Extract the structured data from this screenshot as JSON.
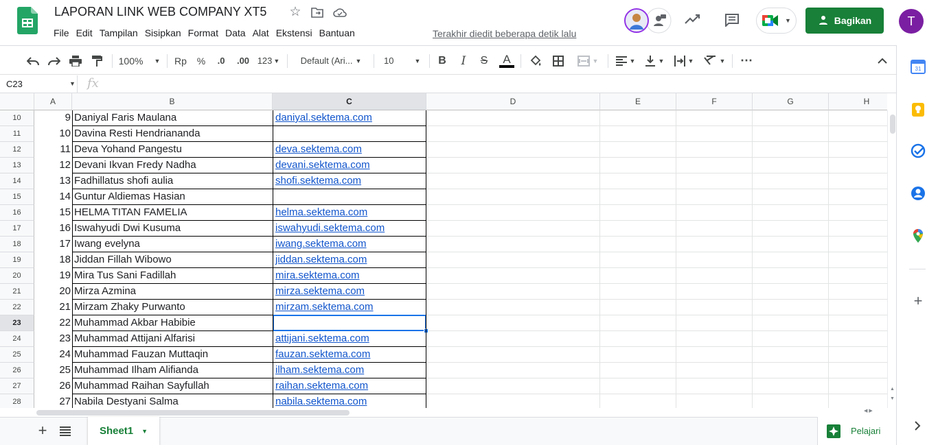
{
  "window": {
    "title": "LAPORAN LINK WEB COMPANY XT5",
    "last_edit": "Terakhir diedit beberapa detik lalu"
  },
  "menu": [
    "File",
    "Edit",
    "Tampilan",
    "Sisipkan",
    "Format",
    "Data",
    "Alat",
    "Ekstensi",
    "Bantuan"
  ],
  "header": {
    "share_label": "Bagikan",
    "user_initial": "T"
  },
  "toolbar": {
    "zoom": "100%",
    "currency": "Rp",
    "percent": "%",
    "dec_less": ".0",
    "dec_more": ".00",
    "format_more": "123",
    "font": "Default (Ari...",
    "font_size": "10",
    "bold": "B",
    "italic": "I",
    "strike": "S",
    "text_color_letter": "A",
    "more": "⋯"
  },
  "formula_bar": {
    "name_box": "C23",
    "fx": "fx",
    "value": ""
  },
  "columns": [
    "A",
    "B",
    "C",
    "D",
    "E",
    "F",
    "G",
    "H"
  ],
  "rows": [
    {
      "row": "10",
      "no": "9",
      "name": "Daniyal Faris Maulana",
      "link": "daniyal.sektema.com"
    },
    {
      "row": "11",
      "no": "10",
      "name": "Davina Resti Hendriananda",
      "link": ""
    },
    {
      "row": "12",
      "no": "11",
      "name": "Deva Yohand Pangestu",
      "link": "deva.sektema.com"
    },
    {
      "row": "13",
      "no": "12",
      "name": "Devani Ikvan Fredy Nadha",
      "link": "devani.sektema.com"
    },
    {
      "row": "14",
      "no": "13",
      "name": "Fadhillatus shofi aulia",
      "link": "shofi.sektema.com"
    },
    {
      "row": "15",
      "no": "14",
      "name": "Guntur Aldiemas Hasian",
      "link": ""
    },
    {
      "row": "16",
      "no": "15",
      "name": "HELMA TITAN FAMELIA",
      "link": "helma.sektema.com"
    },
    {
      "row": "17",
      "no": "16",
      "name": "Iswahyudi Dwi Kusuma",
      "link": "iswahyudi.sektema.com"
    },
    {
      "row": "18",
      "no": "17",
      "name": "Iwang evelyna",
      "link": "iwang.sektema.com"
    },
    {
      "row": "19",
      "no": "18",
      "name": "Jiddan Fillah Wibowo",
      "link": "jiddan.sektema.com"
    },
    {
      "row": "20",
      "no": "19",
      "name": "Mira Tus Sani Fadillah",
      "link": "mira.sektema.com"
    },
    {
      "row": "21",
      "no": "20",
      "name": "Mirza Azmina",
      "link": "mirza.sektema.com"
    },
    {
      "row": "22",
      "no": "21",
      "name": "Mirzam Zhaky Purwanto",
      "link": "mirzam.sektema.com"
    },
    {
      "row": "23",
      "no": "22",
      "name": "Muhammad Akbar Habibie",
      "link": ""
    },
    {
      "row": "24",
      "no": "23",
      "name": "Muhammad Attijani Alfarisi",
      "link": "attijani.sektema.com"
    },
    {
      "row": "25",
      "no": "24",
      "name": "Muhammad Fauzan Muttaqin",
      "link": "fauzan.sektema.com"
    },
    {
      "row": "26",
      "no": "25",
      "name": "Muhammad Ilham Alifianda",
      "link": "ilham.sektema.com"
    },
    {
      "row": "27",
      "no": "26",
      "name": "Muhammad Raihan Sayfullah",
      "link": "raihan.sektema.com"
    },
    {
      "row": "28",
      "no": "27",
      "name": "Nabila Destyani Salma",
      "link": "nabila.sektema.com"
    }
  ],
  "selected_cell": "C23",
  "sheets": {
    "active": "Sheet1",
    "explore_label": "Pelajari"
  },
  "colors": {
    "brand_green": "#188038",
    "link": "#1155cc",
    "selection": "#1a73e8",
    "avatar": "#7b1fa2"
  },
  "icons": [
    "sheets-logo-icon",
    "star-icon",
    "move-folder-icon",
    "cloud-status-icon",
    "collaborator-avatar-icon",
    "activity-trend-icon",
    "comment-icon",
    "meet-icon",
    "lock-person-icon",
    "undo-icon",
    "redo-icon",
    "print-icon",
    "paint-format-icon",
    "fill-color-icon",
    "borders-icon",
    "merge-icon",
    "align-left-icon",
    "valign-bottom-icon",
    "wrap-icon",
    "rotate-icon",
    "collapse-icon",
    "add-sheet-icon",
    "sheet-list-icon",
    "explore-icon",
    "calendar-icon",
    "keep-icon",
    "tasks-icon",
    "contacts-icon",
    "maps-icon",
    "add-addon-icon",
    "chevron-right-icon"
  ]
}
